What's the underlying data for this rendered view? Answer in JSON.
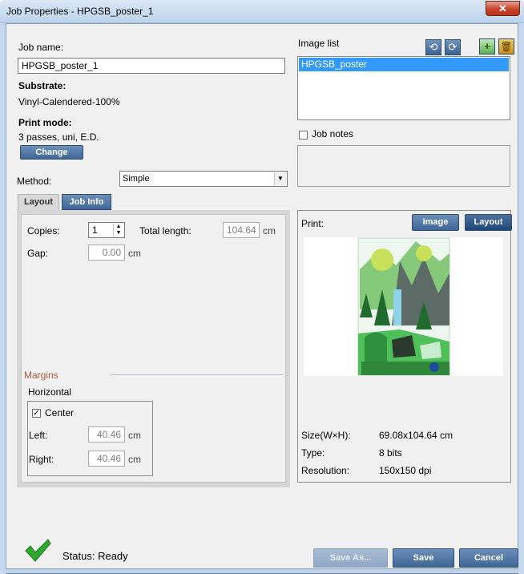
{
  "window": {
    "title": "Job Properties - HPGSB_poster_1",
    "close_glyph": "✕"
  },
  "job": {
    "name_label": "Job name:",
    "name_value": "HPGSB_poster_1",
    "substrate_label": "Substrate:",
    "substrate_value": "Vinyl-Calendered-100%",
    "print_mode_label": "Print mode:",
    "print_mode_value": "3 passes, uni, E.D.",
    "change_label": "Change",
    "method_label": "Method:",
    "method_value": "Simple"
  },
  "image_list": {
    "label": "Image list",
    "items": [
      "HPGSB_poster"
    ],
    "tool_icons": [
      "rotate-left-icon",
      "rotate-right-icon",
      "add-image-icon",
      "delete-icon"
    ]
  },
  "job_notes": {
    "label": "Job notes",
    "checked": false
  },
  "tabs": [
    {
      "label": "Layout",
      "active": true
    },
    {
      "label": "Job Info",
      "active": false
    }
  ],
  "layout": {
    "copies_label": "Copies:",
    "copies_value": "1",
    "total_length_label": "Total length:",
    "total_length_value": "104.64",
    "total_length_unit": "cm",
    "gap_label": "Gap:",
    "gap_value": "0.00",
    "gap_unit": "cm",
    "margins_label": "Margins",
    "horizontal_label": "Horizontal",
    "center_label": "Center",
    "center_checked": true,
    "left_label": "Left:",
    "left_value": "40.46",
    "left_unit": "cm",
    "right_label": "Right:",
    "right_value": "40.46",
    "right_unit": "cm"
  },
  "print_panel": {
    "label": "Print:",
    "image_button": "Image",
    "layout_button": "Layout",
    "size_label": "Size(W×H):",
    "size_value": "69.08x104.64 cm",
    "type_label": "Type:",
    "type_value": "8 bits",
    "resolution_label": "Resolution:",
    "resolution_value": "150x150 dpi"
  },
  "status": {
    "label": "Status: Ready",
    "state": "ready"
  },
  "footer": {
    "save_as": "Save As...",
    "save": "Save",
    "cancel": "Cancel"
  },
  "colors": {
    "accent": "#3f6797",
    "selection": "#3399ff",
    "margins_heading": "#b05a3c",
    "status_ok": "#2fa82f"
  }
}
